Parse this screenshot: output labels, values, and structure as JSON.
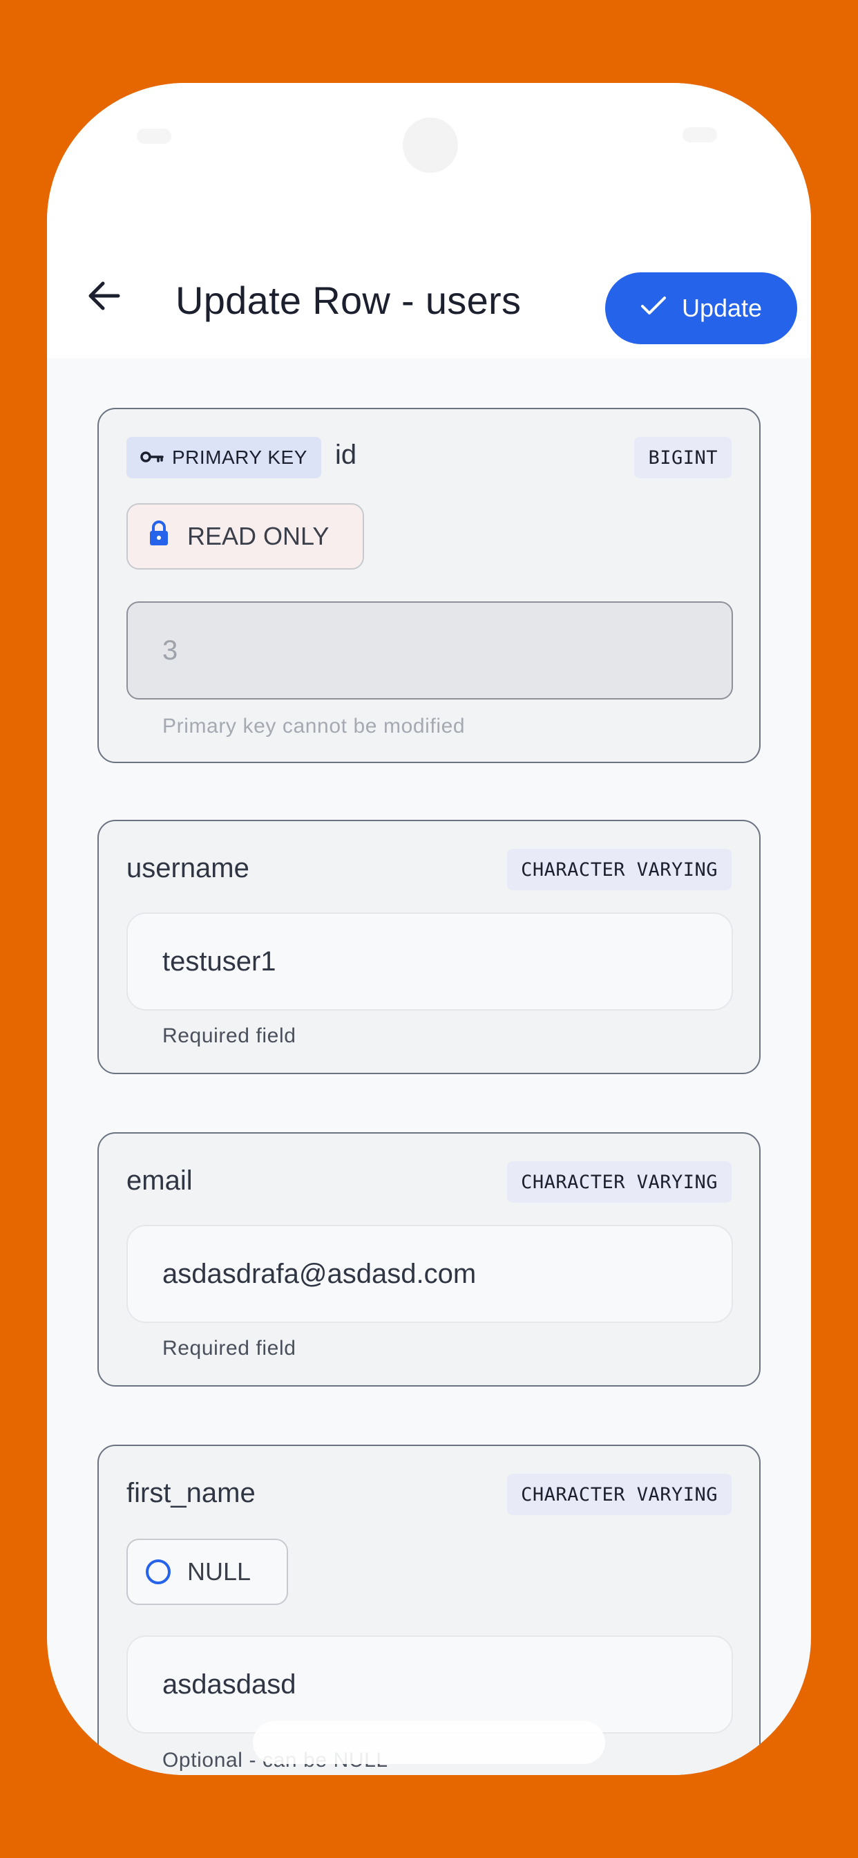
{
  "header": {
    "title": "Update Row - users",
    "update_label": "Update"
  },
  "icons": {
    "back": "arrow-left-icon",
    "check": "check-icon",
    "key": "key-icon",
    "lock": "lock-icon",
    "radio": "radio-unchecked-icon"
  },
  "colors": {
    "accent": "#2563EB",
    "background": "#E66600"
  },
  "fields": [
    {
      "name": "id",
      "type": "BIGINT",
      "pk_label": "PRIMARY KEY",
      "readonly_label": "READ ONLY",
      "value": "3",
      "helper": "Primary key cannot be modified"
    },
    {
      "name": "username",
      "type": "CHARACTER VARYING",
      "value": "testuser1",
      "helper": "Required field"
    },
    {
      "name": "email",
      "type": "CHARACTER VARYING",
      "value": "asdasdrafa@asdasd.com",
      "helper": "Required field"
    },
    {
      "name": "first_name",
      "type": "CHARACTER VARYING",
      "null_label": "NULL",
      "value": "asdasdasd",
      "helper": "Optional - can be NULL"
    }
  ]
}
